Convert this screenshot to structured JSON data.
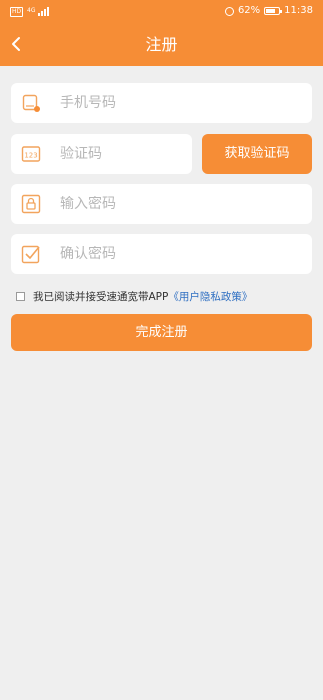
{
  "status_bar": {
    "network": "HD",
    "signal": "4G",
    "battery": "62%",
    "time": "11:38"
  },
  "nav": {
    "title": "注册"
  },
  "form": {
    "phone": {
      "placeholder": "手机号码",
      "value": "",
      "icon": "phone-icon"
    },
    "code": {
      "placeholder": "验证码",
      "value": "",
      "icon": "code-123-icon"
    },
    "password": {
      "placeholder": "输入密码",
      "value": "",
      "icon": "lock-icon"
    },
    "confirm": {
      "placeholder": "确认密码",
      "value": "",
      "icon": "check-icon"
    },
    "get_code_label": "获取验证码"
  },
  "agreement": {
    "text": "我已阅读并接受速通宽带APP",
    "policy_link": "《用户隐私政策》",
    "checked": false
  },
  "submit_label": "完成注册",
  "colors": {
    "accent": "#f68d36",
    "background": "#efefef",
    "link": "#2f6fc2"
  }
}
